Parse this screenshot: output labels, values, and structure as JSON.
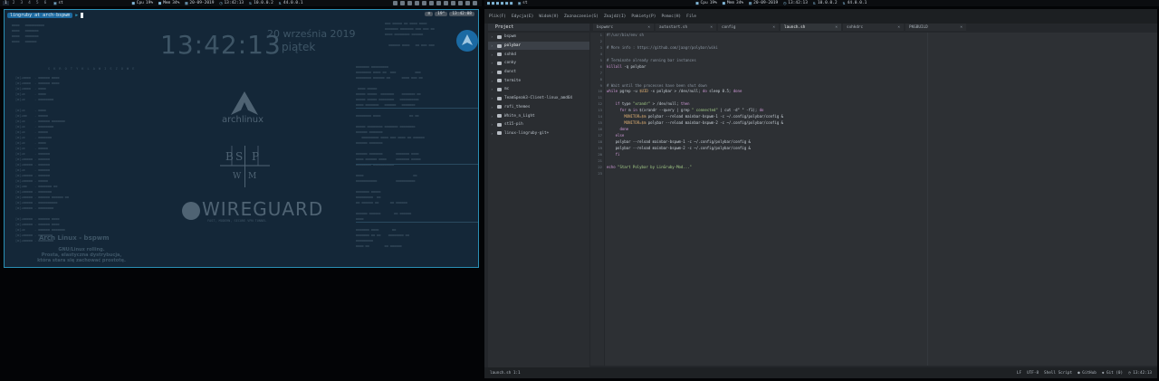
{
  "bar_left": {
    "workspaces": [
      "1",
      "2",
      "3",
      "4",
      "5",
      "6"
    ],
    "window_title": "st",
    "cpu_label": "Cpu",
    "cpu_value": "19%",
    "mem_label": "Mem",
    "mem_value": "34%",
    "date": "20-09-2019",
    "time": "13:42:13",
    "ip_local": "10.0.0.2",
    "ip_vpn": "44.0.0.1"
  },
  "bar_right": {
    "window_title": "st",
    "cpu_label": "Cpu",
    "cpu_value": "19%",
    "mem_label": "Mem",
    "mem_value": "34%",
    "date": "20-09-2019",
    "time": "13:42:13",
    "ip_local": "10.0.0.2",
    "ip_vpn": "44.0.0.1"
  },
  "terminal": {
    "prompt_user": "lingruby at arch-bspwm",
    "right_badges": [
      "≡",
      "19°",
      "13:42:08"
    ]
  },
  "desktop": {
    "clock": "13:42:13",
    "date_day": "20 września 2019",
    "weekday": "piątek",
    "shortcuts_title": "S K R O T Y   K L A W I S Z O W E",
    "arch_text": "archlinux",
    "bspwm_letters": [
      "B",
      "S",
      "P",
      "W",
      "M"
    ],
    "wireguard_text": "WIREGUARD",
    "wireguard_sub": "FAST, MODERN, SECURE VPN TUNNEL",
    "footer_title": "Arch Linux - bspwm",
    "quote_lines": [
      "GNU/Linux rolling.",
      "Prosta, elastyczna dystrybucja,",
      "która stara się zachować prostotę."
    ]
  },
  "editor": {
    "menu": [
      "Plik(F)",
      "Edycja(E)",
      "Widok(V)",
      "Zaznaczenie(S)",
      "Znajdź(I)",
      "Pakiety(P)",
      "Pomoc(H)",
      "File"
    ],
    "project_tab": "Project",
    "tree": [
      {
        "label": "bspwm",
        "selected": false
      },
      {
        "label": "polybar",
        "selected": true
      },
      {
        "label": "sxhkd",
        "selected": false
      },
      {
        "label": "conky",
        "selected": false
      },
      {
        "label": "dunst",
        "selected": false
      },
      {
        "label": "termite",
        "selected": false
      },
      {
        "label": "mc",
        "selected": false
      },
      {
        "label": "TeamSpeak3-Client-linux_amd64",
        "selected": false
      },
      {
        "label": "rofi_themes",
        "selected": false
      },
      {
        "label": "White_n_Light",
        "selected": false
      },
      {
        "label": "st15-pih",
        "selected": false
      },
      {
        "label": "linux-lingruby-git+",
        "selected": false
      }
    ],
    "tabs": [
      {
        "label": "bspwmrc",
        "active": false
      },
      {
        "label": "autostart.sh",
        "active": false
      },
      {
        "label": "config",
        "active": false
      },
      {
        "label": "launch.sh",
        "active": true
      },
      {
        "label": "sxhkdrc",
        "active": false
      },
      {
        "label": "PKGBUILD",
        "active": false
      }
    ],
    "code": [
      [
        [
          "c-comment",
          "#!/usr/bin/env sh"
        ]
      ],
      [
        [
          "",
          ""
        ]
      ],
      [
        [
          "c-comment",
          "# More info : https://github.com/jaagr/polybar/wiki"
        ]
      ],
      [
        [
          "",
          ""
        ]
      ],
      [
        [
          "c-comment",
          "# Terminate already running bar instances"
        ]
      ],
      [
        [
          "c-kw",
          "killall"
        ],
        [
          "",
          " -q polybar"
        ]
      ],
      [
        [
          "",
          ""
        ]
      ],
      [
        [
          "",
          ""
        ]
      ],
      [
        [
          "c-comment",
          "# Wait until the processes have been shut down"
        ]
      ],
      [
        [
          "c-kw",
          "while"
        ],
        [
          "",
          " pgrep -u "
        ],
        [
          "c-var",
          "$UID"
        ],
        [
          "",
          " -x polybar > /dev/null; "
        ],
        [
          "c-kw",
          "do"
        ],
        [
          "",
          " sleep 0.5; "
        ],
        [
          "c-kw",
          "done"
        ]
      ],
      [
        [
          "",
          ""
        ]
      ],
      [
        [
          "",
          "    "
        ],
        [
          "c-kw",
          "if"
        ],
        [
          "",
          " type "
        ],
        [
          "c-str",
          "\"xrandr\""
        ],
        [
          "",
          " > /dev/null; "
        ],
        [
          "c-kw",
          "then"
        ]
      ],
      [
        [
          "",
          "      "
        ],
        [
          "c-kw",
          "for"
        ],
        [
          "",
          " m "
        ],
        [
          "c-kw",
          "in"
        ],
        [
          "",
          " $(xrandr --query | grep "
        ],
        [
          "c-str",
          "\" connected\""
        ],
        [
          "",
          " | cut -d\" \" -f1); "
        ],
        [
          "c-kw",
          "do"
        ]
      ],
      [
        [
          "",
          "        "
        ],
        [
          "c-var",
          "MONITOR=$m"
        ],
        [
          "",
          " polybar --reload mainbar-bspwm-1 -c ~/.config/polybar/config &"
        ]
      ],
      [
        [
          "",
          "        "
        ],
        [
          "c-var",
          "MONITOR=$m"
        ],
        [
          "",
          " polybar --reload mainbar-bspwm-2 -c ~/.config/polybar/config &"
        ]
      ],
      [
        [
          "",
          "      "
        ],
        [
          "c-kw",
          "done"
        ]
      ],
      [
        [
          "",
          "    "
        ],
        [
          "c-kw",
          "else"
        ]
      ],
      [
        [
          "",
          "    polybar --reload mainbar-bspwm-1 -c ~/.config/polybar/config &"
        ]
      ],
      [
        [
          "",
          "    polybar --reload mainbar-bspwm-2 -c ~/.config/polybar/config &"
        ]
      ],
      [
        [
          "",
          "    "
        ],
        [
          "c-kw",
          "fi"
        ]
      ],
      [
        [
          "",
          ""
        ]
      ],
      [
        [
          "c-kw",
          "echo"
        ],
        [
          "c-str",
          " \"Start Polybar by LinGruby-Mod...\""
        ]
      ],
      [
        [
          "",
          ""
        ]
      ]
    ],
    "status_left": "launch.sh  1:1",
    "status_right": [
      "LF",
      "UTF-8",
      "Shell Script",
      "GitHub",
      "Git (0)",
      "13:42:13"
    ]
  }
}
